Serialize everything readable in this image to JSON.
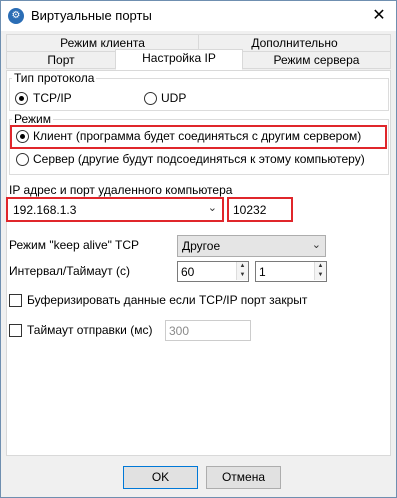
{
  "window": {
    "title": "Виртуальные порты",
    "icon": "app-gear-icon",
    "close_glyph": "✕"
  },
  "tabs_row1": [
    {
      "label": "Режим клиента"
    },
    {
      "label": "Дополнительно"
    }
  ],
  "tabs_row2": [
    {
      "label": "Порт"
    },
    {
      "label": "Настройка IP",
      "active": true
    },
    {
      "label": "Режим сервера"
    }
  ],
  "protocol": {
    "group_label": "Тип протокола",
    "options": [
      {
        "label": "TCP/IP",
        "checked": true
      },
      {
        "label": "UDP",
        "checked": false
      }
    ]
  },
  "mode": {
    "group_label": "Режим",
    "options": [
      {
        "label": "Клиент (программа будет соединяться с другим сервером)",
        "checked": true
      },
      {
        "label": "Сервер (другие будут подсоединяться к этому компьютеру)",
        "checked": false
      }
    ]
  },
  "remote": {
    "label": "IP адрес и порт удаленного компьютера",
    "ip": "192.168.1.3",
    "port": "10232"
  },
  "keepalive": {
    "label": "Режим \"keep alive\" TCP",
    "selected": "Другое"
  },
  "interval": {
    "label": "Интервал/Таймаут (с)",
    "interval_value": "60",
    "timeout_value": "1"
  },
  "buffer": {
    "label": "Буферизировать данные если TCP/IP порт закрыт",
    "checked": false
  },
  "send_timeout": {
    "label": "Таймаут отправки (мс)",
    "checked": false,
    "value": "300"
  },
  "buttons": {
    "ok": "OK",
    "cancel": "Отмена"
  },
  "colors": {
    "highlight": "#e0262b",
    "focus_border": "#0078d7"
  }
}
